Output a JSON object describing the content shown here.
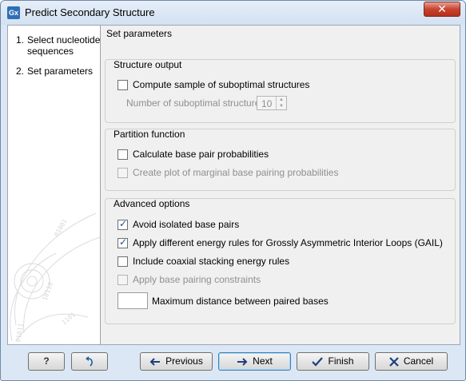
{
  "window": {
    "title": "Predict Secondary Structure",
    "app_icon_text": "Gx",
    "close_glyph": "✕"
  },
  "steps": [
    {
      "num": "1.",
      "label": "Select nucleotide sequences"
    },
    {
      "num": "2.",
      "label": "Set parameters"
    }
  ],
  "panel": {
    "title": "Set parameters",
    "structure_output": {
      "label": "Structure output",
      "compute_sample": {
        "label": "Compute sample of suboptimal structures",
        "checked": false
      },
      "num_suboptimal_label": "Number of suboptimal structures:",
      "num_suboptimal_value": "10"
    },
    "partition_function": {
      "label": "Partition function",
      "calc_base_pair": {
        "label": "Calculate base pair probabilities",
        "checked": false
      },
      "create_plot": {
        "label": "Create plot of marginal base pairing probabilities",
        "checked": false,
        "disabled": true
      }
    },
    "advanced": {
      "label": "Advanced options",
      "avoid_isolated": {
        "label": "Avoid isolated base pairs",
        "checked": true
      },
      "gail": {
        "label": "Apply different energy rules for Grossly Asymmetric Interior Loops (GAIL)",
        "checked": true
      },
      "coaxial": {
        "label": "Include coaxial stacking energy rules",
        "checked": false
      },
      "constraints": {
        "label": "Apply base pairing constraints",
        "checked": false,
        "disabled": true
      },
      "max_distance_label": "Maximum distance between paired bases",
      "max_distance_value": ""
    }
  },
  "footer": {
    "help_label": "?",
    "previous_label": "Previous",
    "next_label": "Next",
    "finish_label": "Finish",
    "cancel_label": "Cancel"
  },
  "colors": {
    "accent": "#2f6fb6",
    "close_red": "#c8432f",
    "window_frame": "#dbe7f4"
  },
  "icons": {
    "help": "question-mark",
    "reset": "reset-arrow-icon",
    "previous": "arrow-left-icon",
    "next": "arrow-right-icon",
    "finish": "checkmark-icon",
    "cancel": "x-icon"
  }
}
